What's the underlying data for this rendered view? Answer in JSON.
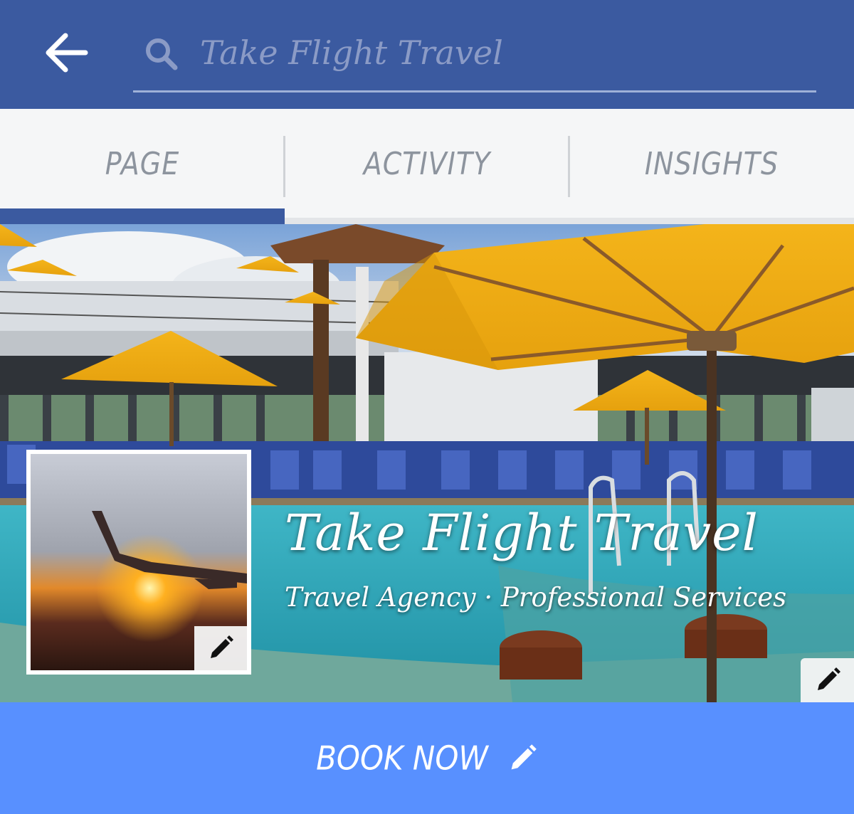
{
  "search": {
    "placeholder": "Take Flight Travel"
  },
  "tabs": [
    {
      "label": "PAGE",
      "active": true
    },
    {
      "label": "ACTIVITY",
      "active": false
    },
    {
      "label": "INSIGHTS",
      "active": false
    }
  ],
  "page": {
    "name": "Take Flight Travel",
    "category": "Travel Agency · Professional Services"
  },
  "book_button": {
    "label": "BOOK NOW"
  },
  "icons": {
    "back": "arrow-left-icon",
    "search": "search-icon",
    "edit": "pencil-icon"
  },
  "colors": {
    "header": "#3b5aa0",
    "book_button": "#5890ff",
    "tab_text": "#8d949e"
  }
}
